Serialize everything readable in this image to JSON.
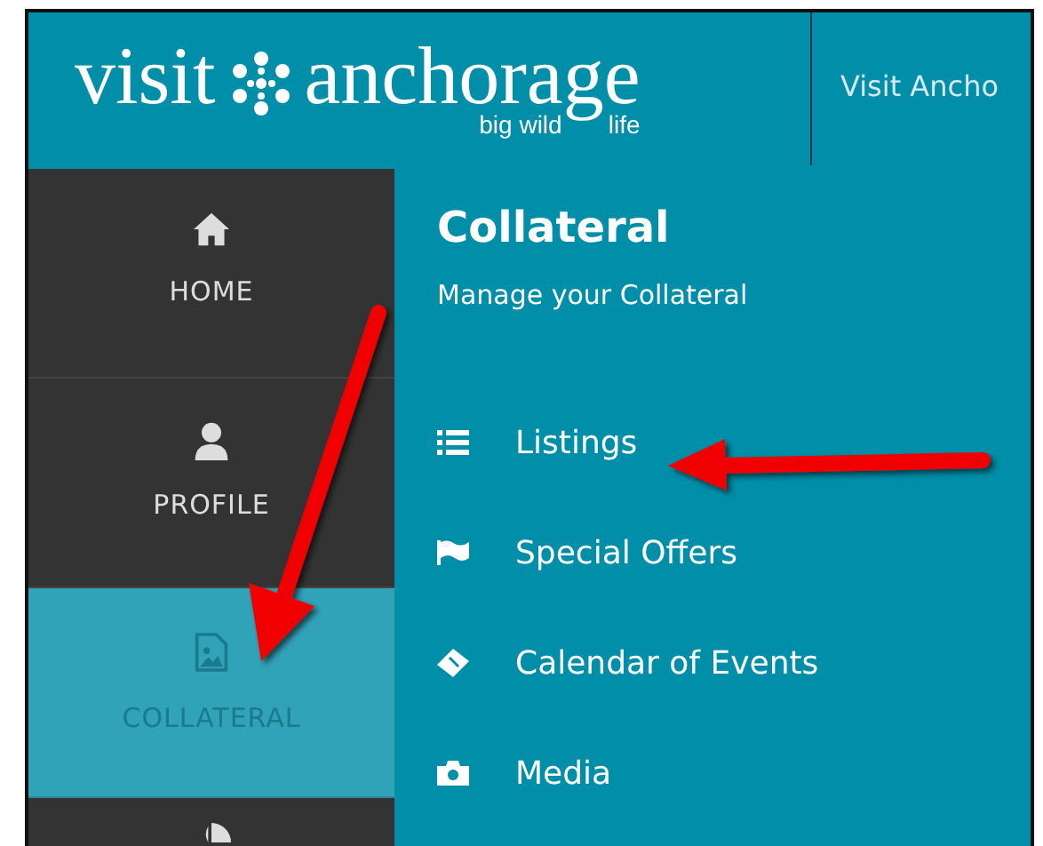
{
  "header": {
    "logo": {
      "word_1": "visit",
      "word_2": "anchorage",
      "tagline_1": "big wild",
      "tagline_2": "life"
    },
    "nav_link": "Visit Ancho"
  },
  "sidebar": {
    "items": [
      {
        "label": "HOME",
        "kind": "home",
        "selected": false
      },
      {
        "label": "PROFILE",
        "kind": "profile",
        "selected": false
      },
      {
        "label": "COLLATERAL",
        "kind": "image",
        "selected": true
      }
    ]
  },
  "content": {
    "title": "Collateral",
    "subtitle": "Manage your Collateral",
    "items": [
      {
        "label": "Listings",
        "kind": "list"
      },
      {
        "label": "Special Offers",
        "kind": "flag"
      },
      {
        "label": "Calendar of Events",
        "kind": "ticket"
      },
      {
        "label": "Media",
        "kind": "camera"
      }
    ]
  }
}
